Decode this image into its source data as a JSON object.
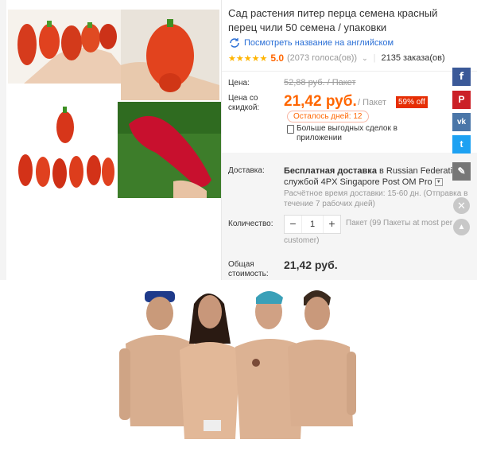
{
  "product": {
    "title": "Сад растения питер перца семена красный перец чили 50 семена / упаковки",
    "translate_link": "Посмотреть название на английском",
    "stars": "★★★★★",
    "rating": "5.0",
    "votes": "(2073 голоса(ов))",
    "orders": "2135 заказа(ов)"
  },
  "price": {
    "label": "Цена:",
    "old": "52,88 руб. / Пакет",
    "discount_label": "Цена со скидкой:",
    "new": "21,42 руб.",
    "unit": "/ Пакет",
    "discount": "59% off",
    "days_left": "Осталось дней: 12",
    "app_deals": "Больше выгодных сделок в приложении"
  },
  "shipping": {
    "label": "Доставка:",
    "method_bold": "Бесплатная доставка",
    "method_rest": " в Russian Federation службой 4PX Singapore Post OM Pro",
    "estimate": "Расчётное время доставки: 15-60 дн. (Отправка в течение 7 рабочих дней)"
  },
  "quantity": {
    "label": "Количество:",
    "minus": "−",
    "value": "1",
    "plus": "+",
    "note": "Пакет (99 Пакеты at most per",
    "note2": "customer)"
  },
  "total": {
    "label": "Общая стоимость:",
    "value": "21,42 руб."
  },
  "share": {
    "facebook": "f",
    "pinterest": "P",
    "vk": "vk",
    "twitter": "t",
    "edit": "✎",
    "close": "✕",
    "up": "▲"
  },
  "colors": {
    "accent": "#ff6600",
    "discount_badge": "#e62e04",
    "link": "#2a6fd6"
  }
}
